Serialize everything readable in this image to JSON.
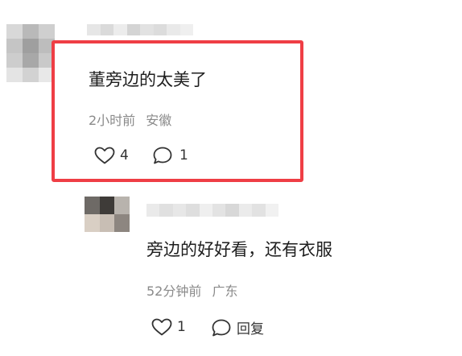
{
  "comments": [
    {
      "text": "董旁边的太美了",
      "time": "2小时前",
      "location": "安徽",
      "like_count": "4",
      "reply_count": "1"
    },
    {
      "text": "旁边的好好看，还有衣服",
      "time": "52分钟前",
      "location": "广东",
      "like_count": "1",
      "reply_label": "回复"
    }
  ],
  "highlight_color": "#ef3e45",
  "icons": [
    "heart-outline-icon",
    "comment-bubble-icon"
  ]
}
